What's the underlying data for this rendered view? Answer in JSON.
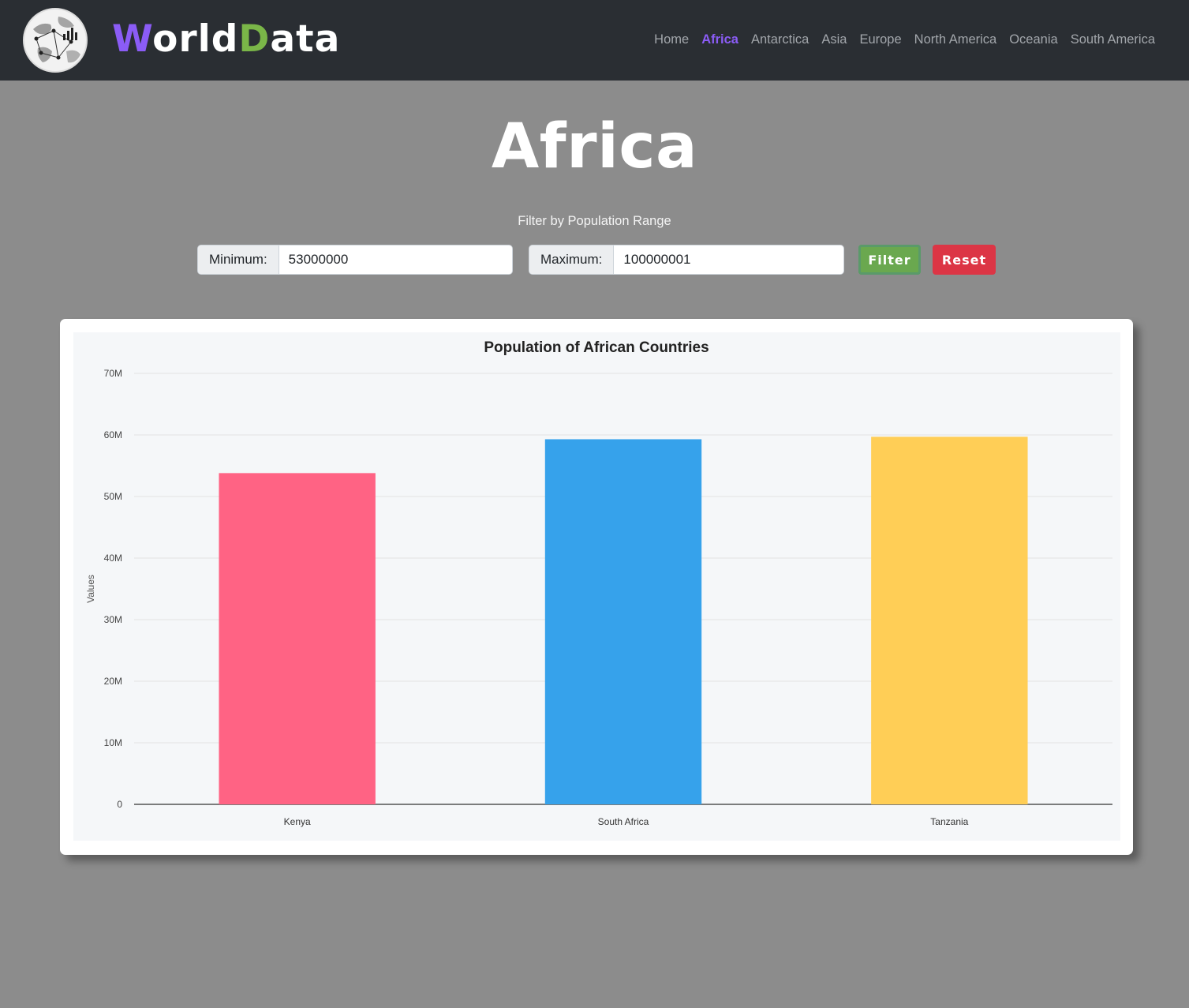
{
  "header": {
    "brand": {
      "first_initial": "W",
      "first_rest": "orld",
      "second_initial": "D",
      "second_rest": "ata"
    },
    "nav": [
      {
        "label": "Home",
        "active": false
      },
      {
        "label": "Africa",
        "active": true
      },
      {
        "label": "Antarctica",
        "active": false
      },
      {
        "label": "Asia",
        "active": false
      },
      {
        "label": "Europe",
        "active": false
      },
      {
        "label": "North America",
        "active": false
      },
      {
        "label": "Oceania",
        "active": false
      },
      {
        "label": "South America",
        "active": false
      }
    ]
  },
  "page": {
    "title": "Africa",
    "filter_caption": "Filter by Population Range"
  },
  "filter": {
    "min_label": "Minimum:",
    "min_value": "53000000",
    "max_label": "Maximum:",
    "max_value": "100000001",
    "filter_button": "Filter",
    "reset_button": "Reset"
  },
  "colors": {
    "brand_purple": "#8b5cf6",
    "brand_green": "#7ab648",
    "nav_text": "#a2a6ab",
    "nav_active": "#8b5cf6",
    "filter_green": "#6aa84f",
    "reset_red": "#dc3545"
  },
  "chart_data": {
    "type": "bar",
    "title": "Population of African Countries",
    "xlabel": "",
    "ylabel": "Values",
    "categories": [
      "Kenya",
      "South Africa",
      "Tanzania"
    ],
    "values": [
      53800000,
      59300000,
      59700000
    ],
    "colors": [
      "#ff6384",
      "#36a2eb",
      "#ffce56"
    ],
    "ylim": [
      0,
      70000000
    ],
    "yticks": [
      0,
      10000000,
      20000000,
      30000000,
      40000000,
      50000000,
      60000000,
      70000000
    ],
    "ytick_labels": [
      "0",
      "10M",
      "20M",
      "30M",
      "40M",
      "50M",
      "60M",
      "70M"
    ],
    "grid": true
  }
}
